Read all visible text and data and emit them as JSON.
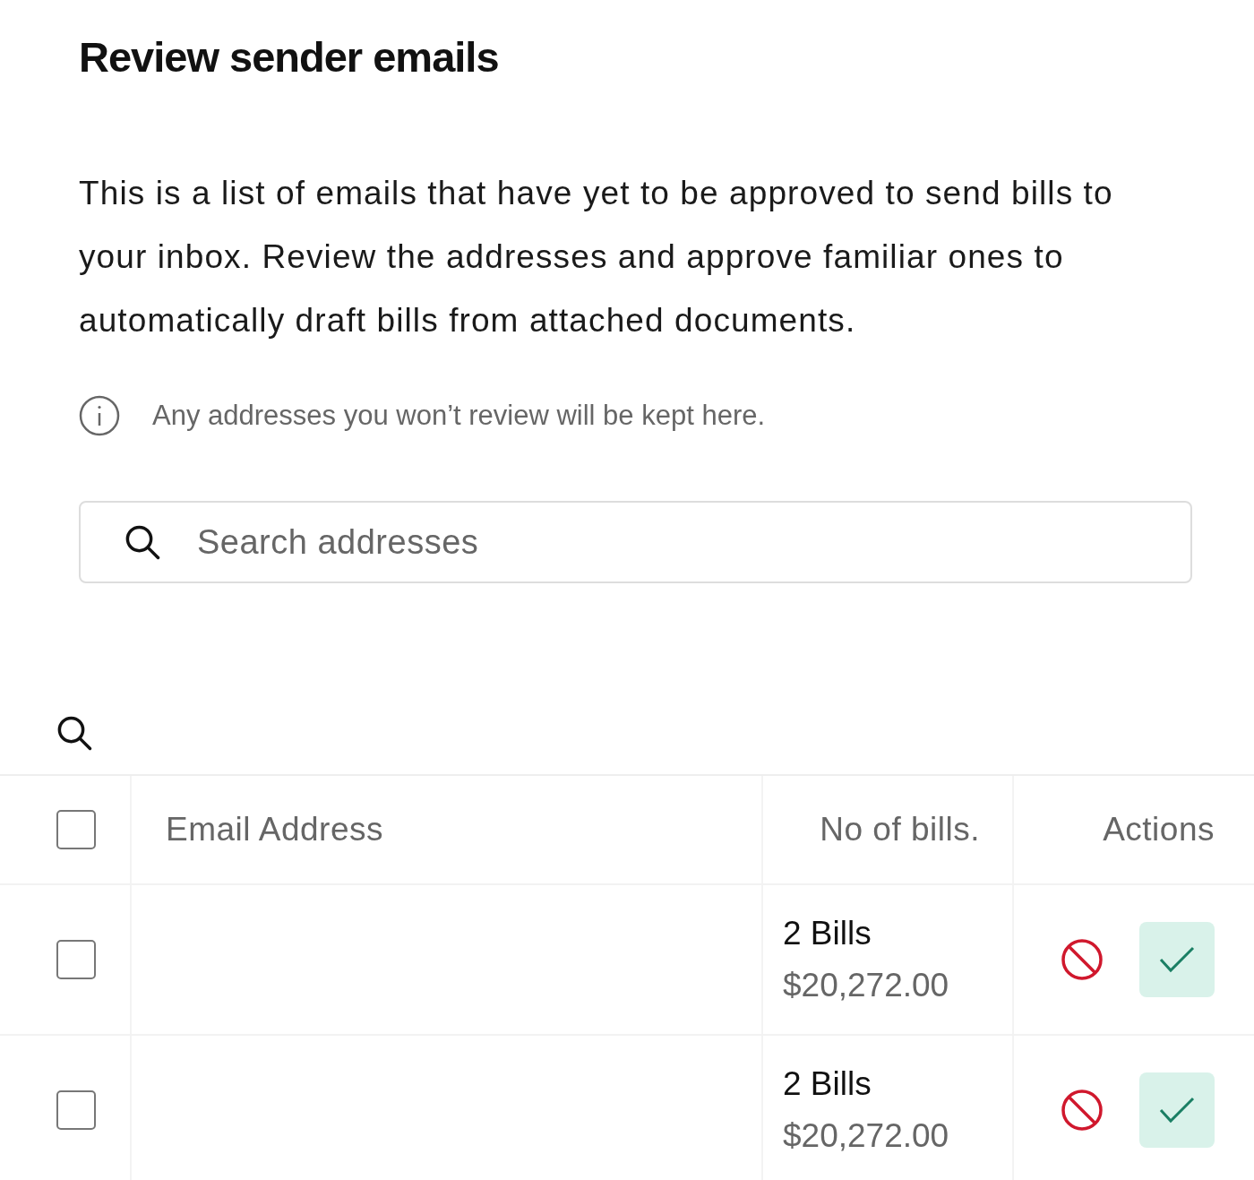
{
  "title": "Review sender emails",
  "description": "This is a list of emails that have yet to be approved to send bills to your inbox. Review the addresses and approve familiar ones to automatically draft bills from attached documents.",
  "note": "Any addresses you won’t review will be kept here.",
  "search": {
    "placeholder": "Search addresses"
  },
  "table": {
    "select_all": {
      "checked": false
    },
    "columns": [
      "Email Address",
      "No of bills.",
      "Actions"
    ],
    "rows": [
      {
        "checked": false,
        "count": "2 Bills",
        "amount": "$20,272.00"
      },
      {
        "checked": false,
        "count": "2 Bills",
        "amount": "$20,272.00"
      }
    ]
  }
}
